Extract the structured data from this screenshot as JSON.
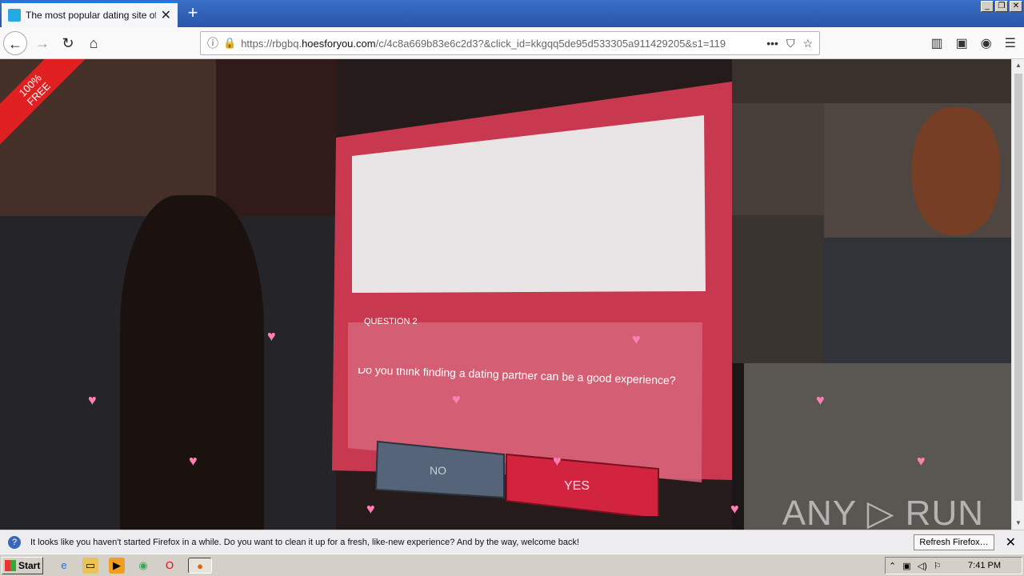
{
  "browser": {
    "tab_title": "The most popular dating site of th",
    "new_tab": "+",
    "url_prefix": "https://rbgbq.",
    "url_domain": "hoesforyou.com",
    "url_rest": "/c/4c8a669b83e6c2d3?&click_id=kkgqq5de95d533305a911429205&s1=119"
  },
  "page": {
    "ribbon": "100%\nFREE",
    "question_label": "QUESTION 2",
    "question_text": "Do you think finding a dating partner can be a good experience?",
    "no_label": "NO",
    "yes_label": "YES",
    "watermark": "ANY ▷ RUN"
  },
  "notification": {
    "message": "It looks like you haven't started Firefox in a while. Do you want to clean it up for a fresh, like-new experience? And by the way, welcome back!",
    "button": "Refresh Firefox…"
  },
  "taskbar": {
    "start": "Start",
    "clock": "7:41 PM"
  },
  "colors": {
    "modal_red": "#c8384f",
    "yes_red": "#d2243f",
    "no_blue": "#556478",
    "heart_pink": "#ff7fb5"
  }
}
